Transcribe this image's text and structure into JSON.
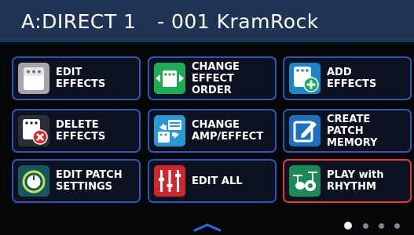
{
  "header": {
    "patch_id": "A:DIRECT 1",
    "patch_name": "- 001 KramRock"
  },
  "menu": [
    {
      "label": "EDIT\nEFFECTS",
      "icon": "edit-effects-icon",
      "color": "#9b9da3"
    },
    {
      "label": "CHANGE\nEFFECT ORDER",
      "icon": "change-effect-order-icon",
      "color": "#1faa55"
    },
    {
      "label": "ADD\nEFFECTS",
      "icon": "add-effects-icon",
      "color": "#1c87c8"
    },
    {
      "label": "DELETE\nEFFECTS",
      "icon": "delete-effects-icon",
      "color": "#2b2f38"
    },
    {
      "label": "CHANGE\nAMP/EFFECT",
      "icon": "change-amp-effect-icon",
      "color": "#2c98d3"
    },
    {
      "label": "CREATE PATCH\nMEMORY",
      "icon": "create-patch-memory-icon",
      "color": "#1d6fc0"
    },
    {
      "label": "EDIT PATCH\nSETTINGS",
      "icon": "edit-patch-settings-icon",
      "color": "#17565f"
    },
    {
      "label": "EDIT ALL",
      "icon": "edit-all-icon",
      "color": "#d0262d"
    },
    {
      "label": "PLAY with\nRHYTHM",
      "icon": "play-with-rhythm-icon",
      "color": "#1c8a55"
    }
  ],
  "pagination": {
    "current": 1,
    "total": 4
  },
  "colors": {
    "title_bar": "#1f3354",
    "tile_border": "#2f55b8",
    "tile_highlight": "#e33a3a",
    "background": "#050608"
  }
}
